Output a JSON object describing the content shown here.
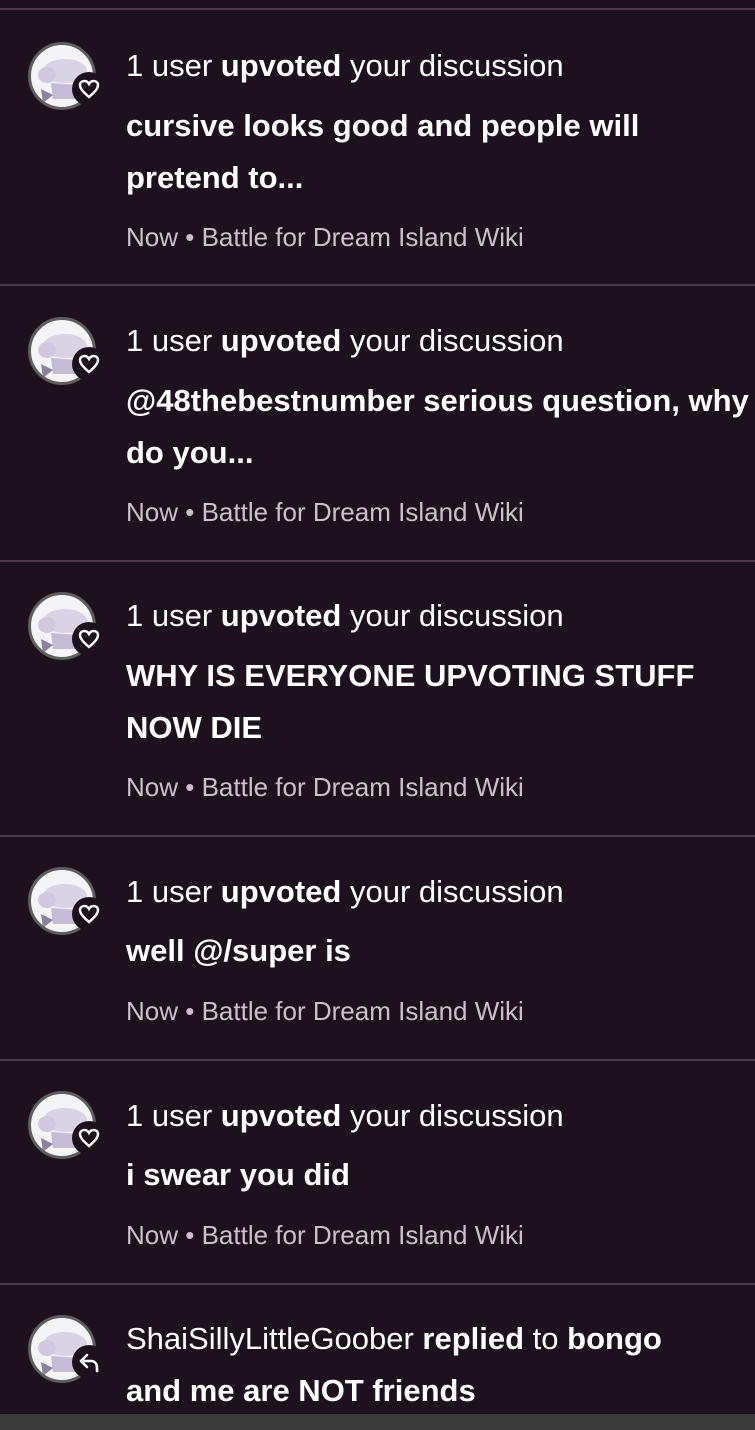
{
  "notifications": [
    {
      "count_text": "1 user",
      "action": "upvoted",
      "object": "your discussion",
      "title": "cursive looks good and people will pretend to...",
      "time": "Now",
      "separator": "•",
      "wiki": "Battle for Dream Island Wiki",
      "badge_icon": "heart-icon"
    },
    {
      "count_text": "1 user",
      "action": "upvoted",
      "object": "your discussion",
      "title": "@48thebestnumber serious question, why do you...",
      "time": "Now",
      "separator": "•",
      "wiki": "Battle for Dream Island Wiki",
      "badge_icon": "heart-icon"
    },
    {
      "count_text": "1 user",
      "action": "upvoted",
      "object": "your discussion",
      "title": "WHY IS EVERYONE UPVOTING STUFF NOW DIE",
      "time": "Now",
      "separator": "•",
      "wiki": "Battle for Dream Island Wiki",
      "badge_icon": "heart-icon"
    },
    {
      "count_text": "1 user",
      "action": "upvoted",
      "object": "your discussion",
      "title": "well @/super is",
      "time": "Now",
      "separator": "•",
      "wiki": "Battle for Dream Island Wiki",
      "badge_icon": "heart-icon"
    },
    {
      "count_text": "1 user",
      "action": "upvoted",
      "object": "your discussion",
      "title": "i swear you did",
      "time": "Now",
      "separator": "•",
      "wiki": "Battle for Dream Island Wiki",
      "badge_icon": "heart-icon"
    }
  ],
  "reply_notification": {
    "user": "ShaiSillyLittleGoober",
    "action": "replied",
    "connector": "to",
    "title_start": "bongo",
    "title_rest": "and me are NOT friends",
    "badge_icon": "reply-arrow-icon"
  },
  "colors": {
    "background": "#1e111e",
    "divider": "#4a3a4a",
    "meta_text": "#c9c2c9"
  }
}
